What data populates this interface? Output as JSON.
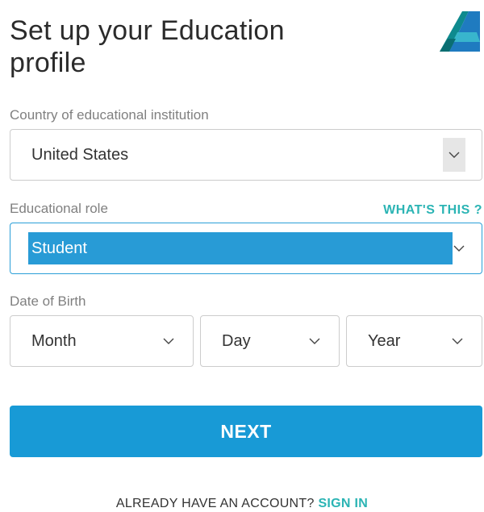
{
  "header": {
    "title": "Set up your Education profile",
    "logo_icon": "autodesk-logo-icon"
  },
  "form": {
    "country": {
      "label": "Country of educational institution",
      "value": "United States"
    },
    "role": {
      "label": "Educational role",
      "help_link": "WHAT'S THIS ?",
      "value": "Student"
    },
    "dob": {
      "label": "Date of Birth",
      "month_value": "Month",
      "day_value": "Day",
      "year_value": "Year"
    },
    "next_label": "NEXT"
  },
  "footer": {
    "prompt": "ALREADY HAVE AN ACCOUNT?",
    "signin_label": "SIGN IN"
  },
  "colors": {
    "accent_blue": "#189ad6",
    "link_teal": "#2bb4b4",
    "selection_blue": "#289bd6"
  }
}
